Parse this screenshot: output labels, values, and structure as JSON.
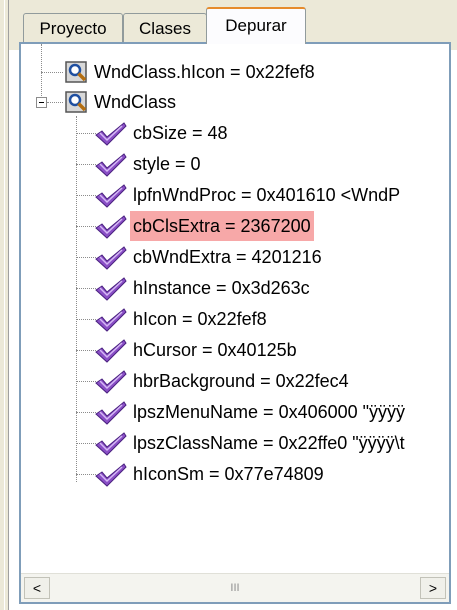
{
  "tabs": [
    {
      "label": "Proyecto"
    },
    {
      "label": "Clases"
    },
    {
      "label": "Depurar"
    }
  ],
  "tree": {
    "root_items": [
      {
        "label": "WndClass.hIcon = 0x22fef8",
        "icon": "watch-magnifier-icon"
      },
      {
        "label": "WndClass",
        "icon": "watch-magnifier-icon",
        "expanded": true
      }
    ],
    "children": [
      {
        "label": "cbSize = 48",
        "highlight": false
      },
      {
        "label": "style = 0",
        "highlight": false
      },
      {
        "label": "lpfnWndProc = 0x401610 <WndP",
        "highlight": false
      },
      {
        "label": "cbClsExtra = 2367200",
        "highlight": true
      },
      {
        "label": "cbWndExtra = 4201216",
        "highlight": false
      },
      {
        "label": "hInstance = 0x3d263c",
        "highlight": false
      },
      {
        "label": "hIcon = 0x22fef8",
        "highlight": false
      },
      {
        "label": "hCursor = 0x40125b",
        "highlight": false
      },
      {
        "label": "hbrBackground = 0x22fec4",
        "highlight": false
      },
      {
        "label": "lpszMenuName = 0x406000 \"ÿÿÿÿ",
        "highlight": false
      },
      {
        "label": "lpszClassName = 0x22ffe0 \"ÿÿÿÿ\\t",
        "highlight": false
      },
      {
        "label": "hIconSm = 0x77e74809",
        "highlight": false
      }
    ]
  },
  "scrollbar": {
    "left_arrow": "<",
    "right_arrow": ">",
    "thumb_grip": "III"
  },
  "colors": {
    "highlight": "#f7a8a8",
    "check_icon": "#8a4fc6",
    "panel_border": "#7f9db9",
    "active_tab_accent": "#e68b2c"
  }
}
